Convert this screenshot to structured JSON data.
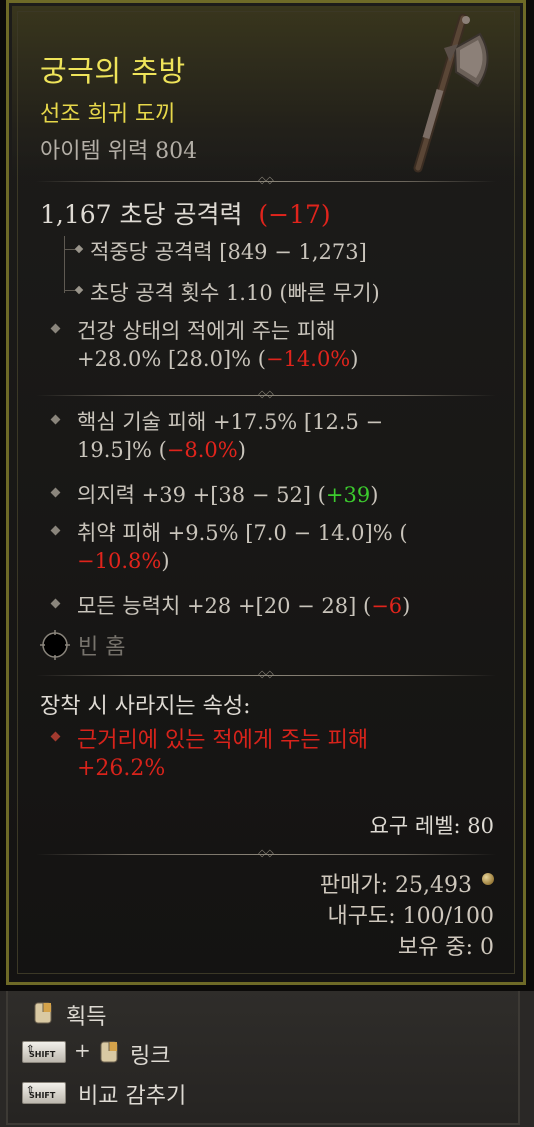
{
  "item": {
    "name": "궁극의 추방",
    "rarity_type": "선조 희귀 도끼",
    "item_power": "아이템 위력 804",
    "icon": "axe-icon"
  },
  "dps": {
    "value": "1,167 초당 공격력",
    "delta": "(−17)"
  },
  "sub_stats": [
    {
      "text": "적중당 공격력 [849 − 1,273]"
    },
    {
      "text": "초당 공격 횟수 1.10 (빠른 무기)"
    }
  ],
  "implicit": {
    "line1": "건강 상태의 적에게 주는 피해",
    "line2_a": "+28.0% [28.0]% (",
    "line2_b": "−14.0%",
    "line2_c": ")"
  },
  "affixes": [
    {
      "a": "핵심 기술 피해 +17.5% [12.5 −",
      "b": "19.5]% (",
      "delta": "−8.0%",
      "c": ")"
    },
    {
      "a": "의지력 +39 +[38 − 52] (",
      "delta": "+39",
      "c": ")"
    },
    {
      "a": "취약 피해 +9.5% [7.0 − 14.0]% (",
      "delta": "−10.8%",
      "c": ")"
    },
    {
      "a": "모든 능력치 +28 +[20 − 28] (",
      "delta": "−6",
      "c": ")"
    }
  ],
  "socket": {
    "label": "빈 홈",
    "icon": "empty-socket-icon"
  },
  "lost_section": {
    "heading": "장착 시 사라지는 속성:",
    "line1": "근거리에 있는 적에게 주는 피해",
    "line2": "+26.2%"
  },
  "footer": {
    "required_level": "요구 레벨: 80",
    "sell_value": "판매가: 25,493",
    "durability": "내구도: 100/100",
    "owned": "보유 중: 0"
  },
  "actions": {
    "acquire": "획득",
    "link_plus": "+",
    "link": "링크",
    "compare": "비교 감추기",
    "shift_key": "SHIFT"
  },
  "colors": {
    "frame": "#6e6a27",
    "title": "#efe45a",
    "negative": "#e0241c",
    "positive": "#3ccb2e"
  }
}
